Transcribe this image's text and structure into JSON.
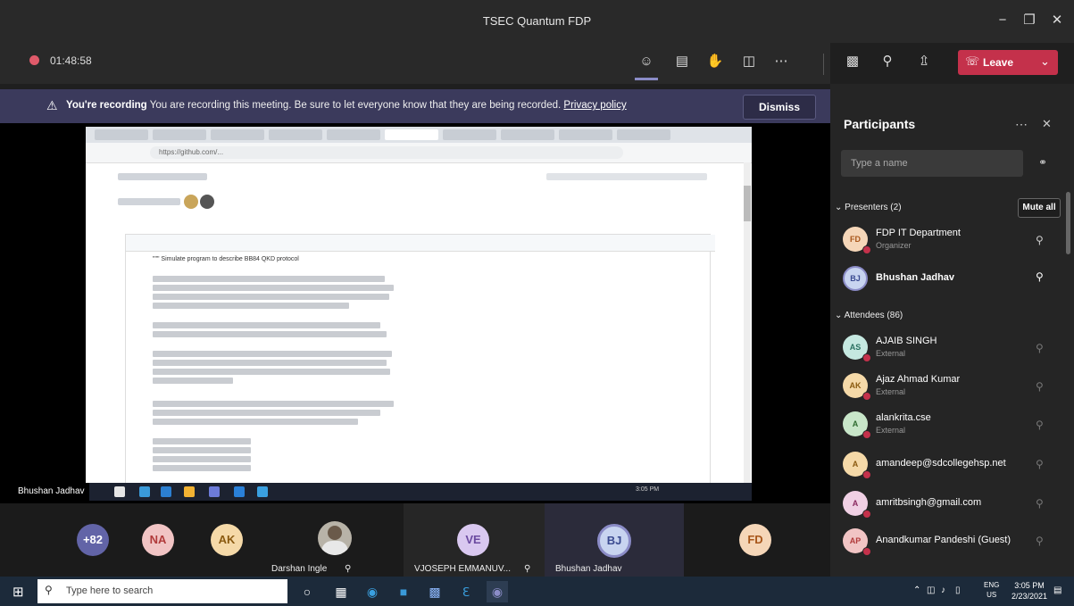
{
  "window": {
    "title": "TSEC Quantum FDP",
    "minimize": "−",
    "maximize": "❐",
    "close": "✕"
  },
  "meeting": {
    "timer": "01:48:58",
    "leave_label": "Leave"
  },
  "banner": {
    "title": "You're recording",
    "message": "You are recording this meeting. Be sure to let everyone know that they are being recorded.",
    "link": "Privacy policy",
    "dismiss": "Dismiss"
  },
  "shared_screen": {
    "url": "https://github.com/...",
    "code_heading": "\"\"\" Simulate program to describe BB84 QKD protocol",
    "sharer_label": "Bhushan Jadhav",
    "clock": "3:05 PM"
  },
  "gallery": {
    "overflow": "+82",
    "tiles": [
      {
        "initials": "NA",
        "name": "",
        "color": "#f1c4c4",
        "text": "#b13a3a"
      },
      {
        "initials": "AK",
        "name": "",
        "color": "#f5d9a8",
        "text": "#8a5a10"
      },
      {
        "initials": "",
        "name": "Darshan Ingle"
      },
      {
        "initials": "VE",
        "name": "VJOSEPH EMMANUV...",
        "color": "#d9c8f0",
        "text": "#6b4aa0"
      },
      {
        "initials": "BJ",
        "name": "Bhushan Jadhav",
        "color": "#c8d4f0",
        "text": "#3a4a90"
      },
      {
        "initials": "FD",
        "name": "",
        "color": "#f5d6b8",
        "text": "#a8561a"
      }
    ]
  },
  "participants": {
    "title": "Participants",
    "search_placeholder": "Type a name",
    "presenters_header": "Presenters (2)",
    "mute_all": "Mute all",
    "attendees_header": "Attendees (86)",
    "presenters": [
      {
        "initials": "FD",
        "name": "FDP IT Department",
        "role": "Organizer",
        "color": "#f5d6b8",
        "text": "#a8561a"
      },
      {
        "initials": "BJ",
        "name": "Bhushan Jadhav",
        "role": "",
        "color": "#c8d4f0",
        "text": "#3a4a90"
      }
    ],
    "attendees": [
      {
        "initials": "AS",
        "name": "AJAIB SINGH",
        "role": "External",
        "color": "#c5e8e0",
        "text": "#2a7060"
      },
      {
        "initials": "AK",
        "name": "Ajaz Ahmad Kumar",
        "role": "External",
        "color": "#f5d9a8",
        "text": "#8a5a10"
      },
      {
        "initials": "A",
        "name": "alankrita.cse",
        "role": "External",
        "color": "#c8e6c9",
        "text": "#2e6b30"
      },
      {
        "initials": "A",
        "name": "amandeep@sdcollegehsp.net",
        "role": "",
        "color": "#f5d9a8",
        "text": "#8a5a10"
      },
      {
        "initials": "A",
        "name": "amritbsingh@gmail.com",
        "role": "",
        "color": "#f0d0e4",
        "text": "#8a2a60"
      },
      {
        "initials": "AP",
        "name": "Anandkumar Pandeshi (Guest)",
        "role": "",
        "color": "#f1c4c4",
        "text": "#b13a3a"
      }
    ]
  },
  "taskbar": {
    "search_placeholder": "Type here to search",
    "time": "3:05 PM",
    "date": "2/23/2021",
    "lang": "ENG",
    "region": "US"
  },
  "colors": {
    "accent": "#8b8cc7",
    "leave": "#c4314b",
    "banner": "#3b3a5c"
  }
}
